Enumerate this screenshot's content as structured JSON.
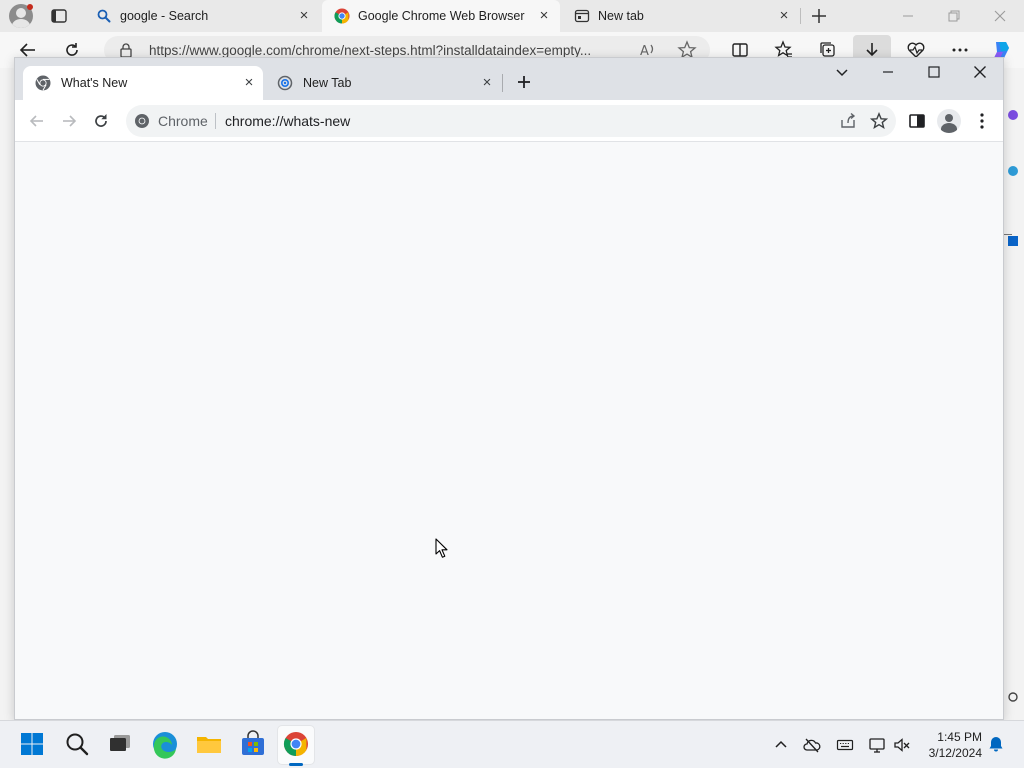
{
  "edge": {
    "tabs": [
      {
        "title": "google - Search",
        "icon": "search-icon"
      },
      {
        "title": "Google Chrome Web Browser",
        "icon": "chrome-logo-icon"
      },
      {
        "title": "New tab",
        "icon": "new-tab-page-icon"
      }
    ],
    "close_glyph": "×",
    "address": "https://www.google.com/chrome/next-steps.html?installdataindex=empty..."
  },
  "chrome": {
    "tabs": [
      {
        "title": "What's New",
        "icon": "chrome-logo-icon"
      },
      {
        "title": "New Tab",
        "icon": "chrome-new-tab-icon"
      }
    ],
    "close_glyph": "×",
    "omnibox": {
      "chip": "Chrome",
      "url": "chrome://whats-new"
    }
  },
  "taskbar": {
    "apps": [
      "start-icon",
      "search-icon",
      "task-view-icon",
      "edge-icon",
      "file-explorer-icon",
      "store-icon",
      "chrome-icon"
    ],
    "clock_time": "1:45 PM",
    "clock_date": "3/12/2024"
  },
  "colors": {
    "edge_tabbar": "#e9e9e9",
    "chrome_tabstrip": "#dee1e6",
    "chrome_content": "#f8f9fa",
    "taskbar": "#eef0f4",
    "accent": "#0067c0"
  }
}
